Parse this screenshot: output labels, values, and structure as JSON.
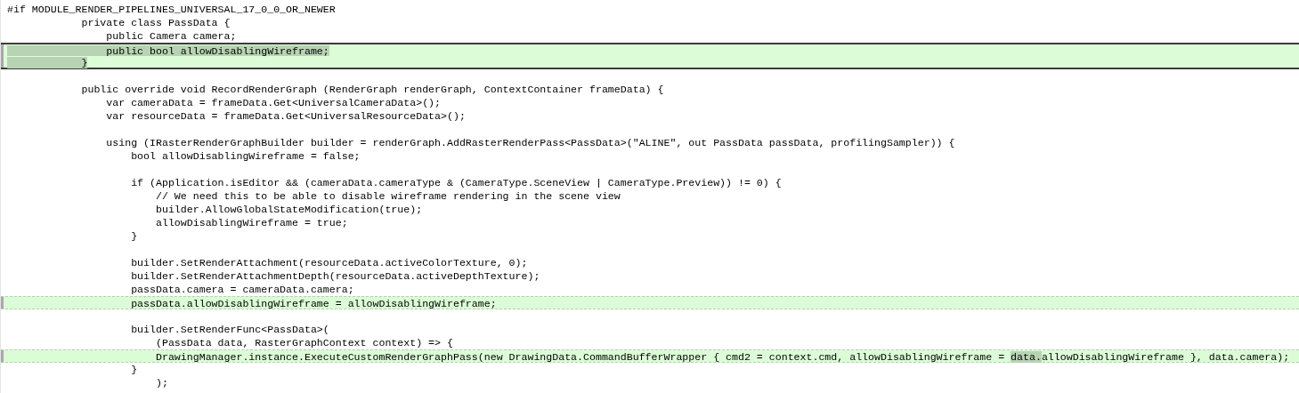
{
  "lines": [
    {
      "kind": "plain",
      "segments": [
        {
          "text": "#if MODULE_RENDER_PIPELINES_UNIVERSAL_17_0_0_OR_NEWER",
          "marked": false
        }
      ]
    },
    {
      "kind": "plain",
      "segments": [
        {
          "text": "            private class PassData {",
          "marked": false
        }
      ]
    },
    {
      "kind": "plain",
      "segments": [
        {
          "text": "                public Camera camera;",
          "marked": false
        }
      ]
    },
    {
      "kind": "current",
      "segments": [
        {
          "text": "                public bool allowDisablingWireframe;",
          "marked": true
        }
      ]
    },
    {
      "kind": "current",
      "segments": [
        {
          "text": "            }",
          "marked": true
        }
      ]
    },
    {
      "kind": "plain"
    },
    {
      "kind": "plain",
      "segments": [
        {
          "text": "            public override void RecordRenderGraph (RenderGraph renderGraph, ContextContainer frameData) {",
          "marked": false
        }
      ]
    },
    {
      "kind": "plain",
      "segments": [
        {
          "text": "                var cameraData = frameData.Get<UniversalCameraData>();",
          "marked": false
        }
      ]
    },
    {
      "kind": "plain",
      "segments": [
        {
          "text": "                var resourceData = frameData.Get<UniversalResourceData>();",
          "marked": false
        }
      ]
    },
    {
      "kind": "plain"
    },
    {
      "kind": "plain",
      "segments": [
        {
          "text": "                using (IRasterRenderGraphBuilder builder = renderGraph.AddRasterRenderPass<PassData>(\"ALINE\", out PassData passData, profilingSampler)) {",
          "marked": false
        }
      ]
    },
    {
      "kind": "plain",
      "segments": [
        {
          "text": "                    bool allowDisablingWireframe = false;",
          "marked": false
        }
      ]
    },
    {
      "kind": "plain"
    },
    {
      "kind": "plain",
      "segments": [
        {
          "text": "                    if (Application.isEditor && (cameraData.cameraType & (CameraType.SceneView | CameraType.Preview)) != 0) {",
          "marked": false
        }
      ]
    },
    {
      "kind": "plain",
      "segments": [
        {
          "text": "                        // We need this to be able to disable wireframe rendering in the scene view",
          "marked": false
        }
      ]
    },
    {
      "kind": "plain",
      "segments": [
        {
          "text": "                        builder.AllowGlobalStateModification(true);",
          "marked": false
        }
      ]
    },
    {
      "kind": "plain",
      "segments": [
        {
          "text": "                        allowDisablingWireframe = true;",
          "marked": false
        }
      ]
    },
    {
      "kind": "plain",
      "segments": [
        {
          "text": "                    }",
          "marked": false
        }
      ]
    },
    {
      "kind": "plain"
    },
    {
      "kind": "plain",
      "segments": [
        {
          "text": "                    builder.SetRenderAttachment(resourceData.activeColorTexture, 0);",
          "marked": false
        }
      ]
    },
    {
      "kind": "plain",
      "segments": [
        {
          "text": "                    builder.SetRenderAttachmentDepth(resourceData.activeDepthTexture);",
          "marked": false
        }
      ]
    },
    {
      "kind": "plain",
      "segments": [
        {
          "text": "                    passData.camera = cameraData.camera;",
          "marked": false
        }
      ]
    },
    {
      "kind": "added",
      "segments": [
        {
          "text": "                    passData.allowDisablingWireframe = allowDisablingWireframe;",
          "marked": false
        }
      ]
    },
    {
      "kind": "plain"
    },
    {
      "kind": "plain",
      "segments": [
        {
          "text": "                    builder.SetRenderFunc<PassData>(",
          "marked": false
        }
      ]
    },
    {
      "kind": "plain",
      "segments": [
        {
          "text": "                        (PassData data, RasterGraphContext context) => {",
          "marked": false
        }
      ]
    },
    {
      "kind": "added",
      "segments": [
        {
          "text": "                        DrawingManager.instance.ExecuteCustomRenderGraphPass(new DrawingData.CommandBufferWrapper { cmd2 = context.cmd, allowDisablingWireframe = ",
          "marked": false
        },
        {
          "text": "data.",
          "marked": true
        },
        {
          "text": "allowDisablingWireframe }, data.camera);",
          "marked": false
        }
      ]
    },
    {
      "kind": "plain",
      "segments": [
        {
          "text": "                    }",
          "marked": false
        }
      ]
    },
    {
      "kind": "plain",
      "segments": [
        {
          "text": "                        );",
          "marked": false
        }
      ]
    }
  ]
}
